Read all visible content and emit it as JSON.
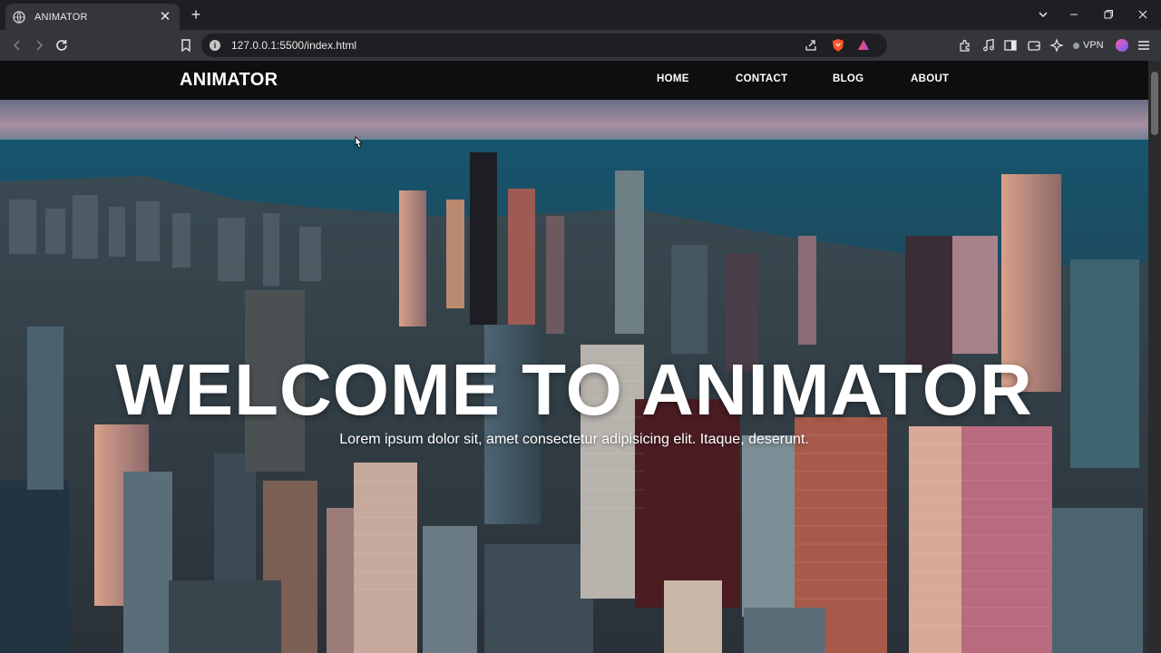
{
  "browser": {
    "tab": {
      "title": "ANIMATOR",
      "close_glyph": "✕",
      "favicon_icon": "globe-icon"
    },
    "new_tab_glyph": "+",
    "window_controls": {
      "dropdown": "⌄",
      "minimize": "–",
      "restore": "❐",
      "close": "✕"
    },
    "address_bar": {
      "url": "127.0.0.1:5500/index.html",
      "info_glyph": "i"
    },
    "vpn_label": "VPN",
    "colors": {
      "chrome_dark": "#1f1f23",
      "chrome": "#35363a",
      "brave_orange": "#fb542b"
    }
  },
  "site": {
    "brand": "ANIMATOR",
    "nav": [
      {
        "label": "HOME"
      },
      {
        "label": "CONTACT"
      },
      {
        "label": "BLOG"
      },
      {
        "label": "ABOUT"
      }
    ],
    "hero": {
      "title": "WELCOME TO ANIMATOR",
      "subtitle": "Lorem ipsum dolor sit, amet consectetur adipisicing elit. Itaque, deserunt.",
      "background": "aerial city skyline at dusk by the lake"
    }
  }
}
